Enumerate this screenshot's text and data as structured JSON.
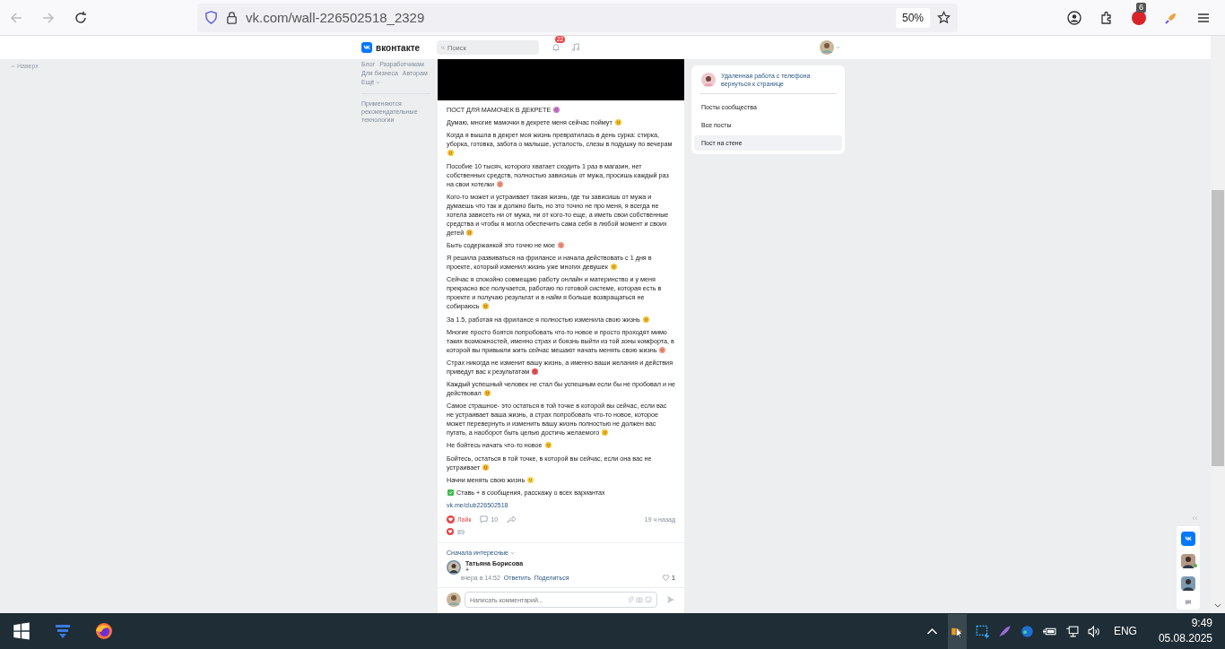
{
  "browser": {
    "url": "vk.com/wall-226502518_2329",
    "zoom": "50%",
    "extension_badge": "6"
  },
  "page": {
    "back_to_top": "Наверх"
  },
  "header": {
    "logo": "вконтакте",
    "search_placeholder": "Поиск",
    "notifications": "22"
  },
  "left_nav": {
    "links": [
      "Блог",
      "Разработчикам",
      "Для бизнеса",
      "Авторам"
    ],
    "more": "Ещё",
    "note": "Применяются рекомендательные технологии"
  },
  "post": {
    "paragraphs": [
      {
        "text": "ПОСТ ДЛЯ МАМОЧЕК В ДЕКРЕТЕ",
        "emoji": {
          "kind": "face",
          "color": "#c77ad6"
        }
      },
      {
        "text": "Думаю, многие мамочки в декрете меня сейчас поймут",
        "emoji": {
          "kind": "face",
          "color": "#f4c430"
        }
      },
      {
        "text": "Когда я вышла в декрет моя жизнь превратилась в день сурка: стирка, уборка, готовка, забота о малыше, усталость, слезы в подушку по вечерам",
        "emoji": {
          "kind": "face",
          "color": "#f4c430"
        }
      },
      {
        "text": "Пособие 10 тысяч, которого хватает сходить 1 раз в магазин, нет собственных средств, полностью зависишь от мужа, просишь каждый раз на свои хотелки",
        "emoji": {
          "kind": "face",
          "color": "#f59a8c"
        }
      },
      {
        "text": "Кого-то может и устраивает такая жизнь, где ты зависишь от мужа и думаешь что так и должно быть, но это точно не про меня, я всегда не хотела зависеть ни от мужа, ни от кого-то еще, а иметь свои собственные средства и чтобы я могла обеспечить сама себя в любой момент и своих детей",
        "emoji": {
          "kind": "face",
          "color": "#f4b730"
        }
      },
      {
        "text": "Быть содержанкой это точно не мое",
        "emoji": {
          "kind": "face",
          "color": "#f59a8c"
        }
      },
      {
        "text": "Я решила развиваться на фрилансе и начала действовать с 1 дня в проекте, который изменил жизнь уже многих девушек",
        "emoji": {
          "kind": "face",
          "color": "#f4c430"
        }
      },
      {
        "text": "Сейчас я спокойно совмещаю работу онлайн и материнство и у меня прекрасно все получается, работаю по готовой системе, которая есть в проекте и получаю результат и в найм я больше возвращаться не собираюсь",
        "emoji": {
          "kind": "face",
          "color": "#f4b730"
        }
      },
      {
        "text": "За 1.5, работая на фрилансе я полностью изменила свою жизнь",
        "emoji": {
          "kind": "face",
          "color": "#f4c430"
        }
      },
      {
        "text": "Многие просто боятся попробовать что-то новое и просто проходят мимо таких возможностей, именно страх и боязнь выйти из той зоны комфорта, в которой вы привыкли жить сейчас мешают начать менять свою жизнь",
        "emoji": {
          "kind": "face",
          "color": "#f59a8c"
        }
      },
      {
        "text": "Страх никогда не изменит вашу жизнь, а именно ваши желания и действия приведут вас к результатам",
        "emoji": {
          "kind": "face",
          "color": "#e8505b"
        }
      },
      {
        "text": "Каждый успешный человек не стал бы успешным если бы не пробовал и не действовал",
        "emoji": {
          "kind": "face",
          "color": "#f4b730"
        }
      },
      {
        "text": "Самое страшное- это остаться в той точке в которой вы сейчас, если вас не устраивает ваша жизнь, а страх попробовать что-то новое, которое может перевернуть и изменить вашу жизнь полностью не должен вас пугать, а наоборот быть целью достичь желаемого",
        "emoji": {
          "kind": "face",
          "color": "#f4c430"
        }
      },
      {
        "text": "Не бойтесь начать что-то новое",
        "emoji": {
          "kind": "face",
          "color": "#f4c430"
        }
      },
      {
        "text": "Бойтесь, остаться в той точке, в которой вы сейчас, если она вас не устраивает",
        "emoji": {
          "kind": "face",
          "color": "#f4b730"
        }
      },
      {
        "text": "Начни менять свою жизнь",
        "emoji": {
          "kind": "face",
          "color": "#f7d54a"
        }
      },
      {
        "text": "Ставь + в сообщения, расскажу о всех вариантах",
        "emoji": {
          "kind": "check",
          "color": "#3fb950"
        }
      }
    ],
    "link": "vk.me/club226502518",
    "like": {
      "label": "Лайк",
      "selected": true
    },
    "comments_count": "10",
    "time": "19 ч назад",
    "reactions": "89"
  },
  "comments": {
    "sort": "Сначала интересные",
    "items": [
      {
        "author": "Татьяна Борисова",
        "text": "+",
        "time": "вчера в 14:52",
        "reply": "Ответить",
        "share": "Поделиться",
        "likes": "1"
      }
    ],
    "input_placeholder": "Написать комментарий..."
  },
  "right_panel": {
    "community": "Удаленная работа с телефона",
    "back": "вернуться к странице",
    "items": [
      {
        "label": "Посты сообщества",
        "selected": false
      },
      {
        "label": "Все посты",
        "selected": false
      },
      {
        "label": "Пост на стене",
        "selected": true
      }
    ]
  },
  "contacts": [
    {
      "online": true
    },
    {
      "online": false
    }
  ],
  "taskbar": {
    "language": "ENG",
    "time": "9:49",
    "date": "05.08.2025"
  }
}
